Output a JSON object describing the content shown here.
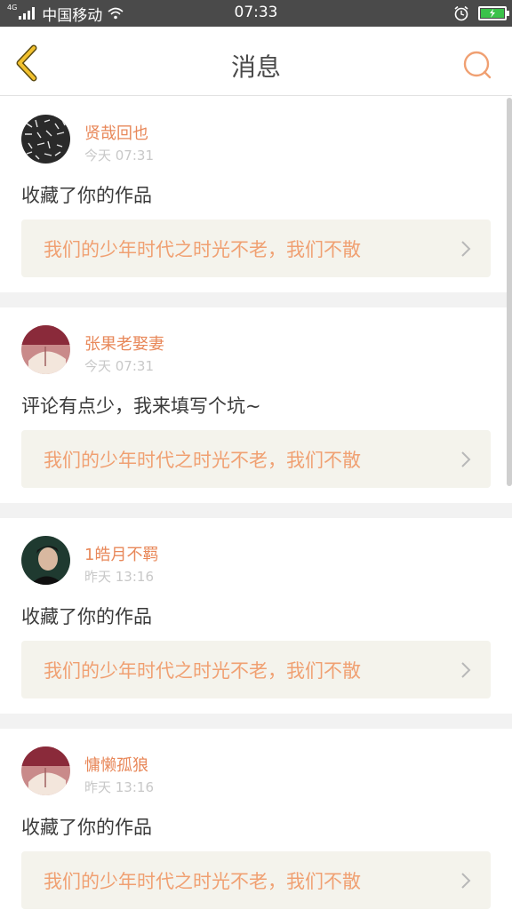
{
  "status_bar": {
    "network": "4G",
    "carrier": "中国移动",
    "time": "07:33"
  },
  "header": {
    "title": "消息",
    "back_icon": "chevron-left-icon",
    "search_icon": "search-icon"
  },
  "colors": {
    "accent": "#e8885a",
    "work_text": "#f0a072",
    "back_arrow": "#f2c12e",
    "work_bg": "#f4f3ec"
  },
  "messages": [
    {
      "username": "贤哉回也",
      "time": "今天 07:31",
      "action": "收藏了你的作品",
      "work_title": "我们的少年时代之时光不老，我们不散"
    },
    {
      "username": "张果老娶妻",
      "time": "今天 07:31",
      "action": "评论有点少，我来填写个坑~",
      "work_title": "我们的少年时代之时光不老，我们不散"
    },
    {
      "username": "1皓月不羁",
      "time": "昨天 13:16",
      "action": "收藏了你的作品",
      "work_title": "我们的少年时代之时光不老，我们不散"
    },
    {
      "username": "慵懒孤狼",
      "time": "昨天 13:16",
      "action": "收藏了你的作品",
      "work_title": "我们的少年时代之时光不老，我们不散"
    }
  ]
}
